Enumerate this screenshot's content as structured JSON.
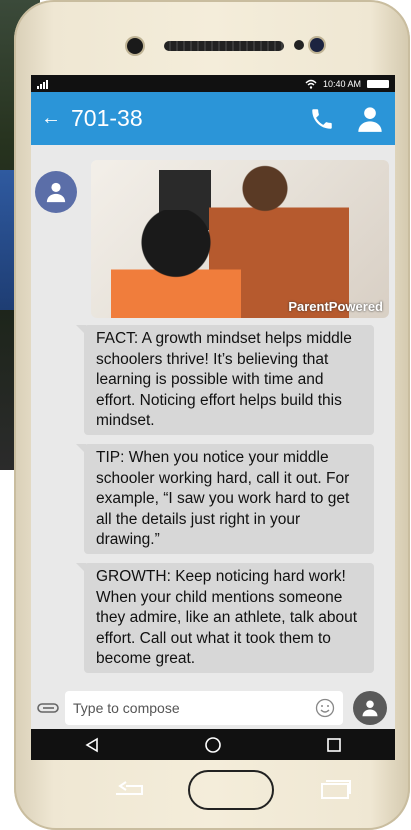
{
  "status_bar": {
    "time": "10:40 AM"
  },
  "header": {
    "title": "701-38",
    "back_icon": "arrow-left-icon",
    "call_icon": "phone-icon",
    "contact_icon": "person-icon"
  },
  "media": {
    "watermark": "ParentPowered"
  },
  "messages": [
    {
      "text": "FACT: A growth mindset helps middle schoolers thrive! It’s believing that learning is possible with time and effort. Noticing effort helps build this mindset."
    },
    {
      "text": "TIP: When you notice your middle schooler working hard, call it out. For example, “I saw you work hard to get all the details just right in your drawing.”"
    },
    {
      "text": "GROWTH: Keep noticing hard work! When your child mentions someone they admire, like an athlete, talk about effort. Call out what it took them to become great."
    }
  ],
  "composer": {
    "placeholder": "Type to compose"
  },
  "colors": {
    "header": "#2b95d8",
    "bubble": "#d7d7d7",
    "avatar": "#5b6ea8",
    "screen_bg": "#e9e9e9"
  }
}
